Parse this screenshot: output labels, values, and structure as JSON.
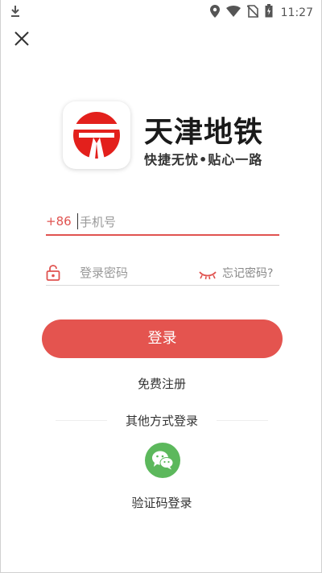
{
  "status_bar": {
    "time": "11:27",
    "icons": [
      "download-icon",
      "location-icon",
      "wifi-icon",
      "no-sim-icon",
      "battery-icon"
    ]
  },
  "header": {
    "close_icon": "close-icon"
  },
  "brand": {
    "name": "天津地铁",
    "slogan": "快捷无忧•贴心一路",
    "logo_color": "#e3201c"
  },
  "login_form": {
    "country_code": "+86",
    "phone_placeholder": "手机号",
    "password_placeholder": "登录密码",
    "forgot_password": "忘记密码?",
    "login_button": "登录",
    "register_link": "免费注册"
  },
  "other_login": {
    "title": "其他方式登录",
    "wechat_icon": "wechat-icon",
    "sms_login": "验证码登录"
  },
  "colors": {
    "accent": "#e4544f",
    "wechat": "#5cb85c"
  }
}
